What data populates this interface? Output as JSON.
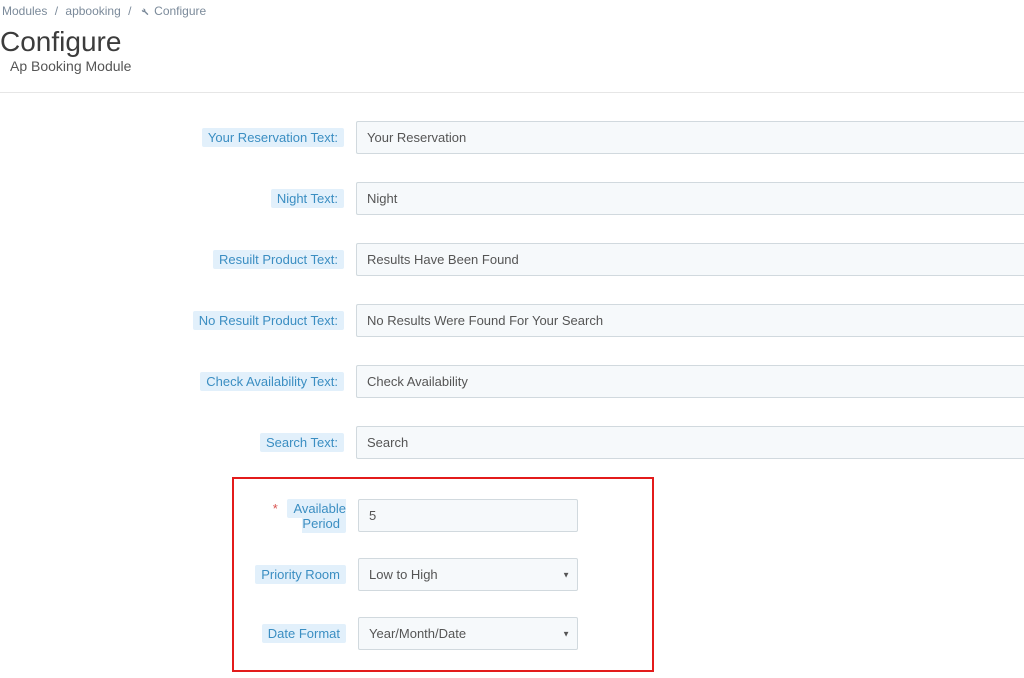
{
  "breadcrumb": {
    "modules": "Modules",
    "apbooking": "apbooking",
    "configure": "Configure"
  },
  "header": {
    "title": "Configure",
    "subtitle": "Ap Booking Module"
  },
  "form": {
    "reservation": {
      "label": "Your Reservation Text:",
      "value": "Your Reservation"
    },
    "night": {
      "label": "Night Text:",
      "value": "Night"
    },
    "result": {
      "label": "Resuilt Product Text:",
      "value": "Results Have Been Found"
    },
    "noresult": {
      "label": "No Resuilt Product Text:",
      "value": "No Results Were Found For Your Search"
    },
    "checkavail": {
      "label": "Check Availability Text:",
      "value": "Check Availability"
    },
    "search": {
      "label": "Search Text:",
      "value": "Search"
    },
    "available_period": {
      "label": "Available Period",
      "value": "5"
    },
    "priority_room": {
      "label": "Priority Room",
      "value": "Low to High"
    },
    "date_format": {
      "label": "Date Format",
      "value": "Year/Month/Date"
    }
  }
}
